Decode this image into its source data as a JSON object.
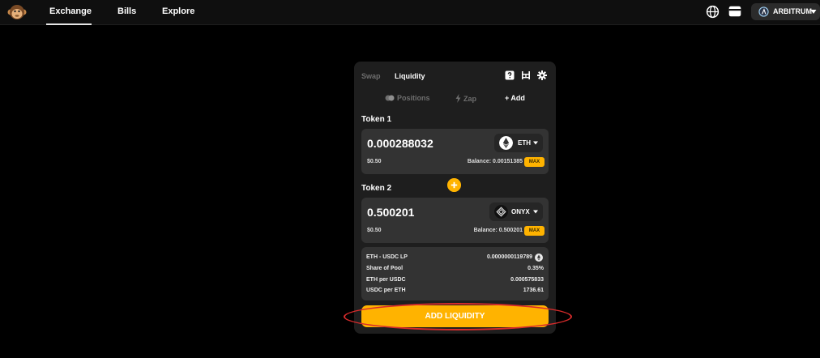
{
  "nav": {
    "items": [
      {
        "label": "Exchange",
        "active": true
      },
      {
        "label": "Bills",
        "active": false
      },
      {
        "label": "Explore",
        "active": false
      }
    ],
    "network_label": "ARBITRUM"
  },
  "card": {
    "tabs": [
      "Swap",
      "Liquidity"
    ],
    "active_tab": "Liquidity",
    "subtabs": {
      "positions": "Positions",
      "zap": "Zap",
      "add": "+ Add"
    },
    "token1": {
      "label": "Token 1",
      "amount": "0.000288032",
      "symbol": "ETH",
      "usd": "$0.50",
      "balance": "Balance: 0.00151385",
      "max_label": "MAX"
    },
    "token2": {
      "label": "Token 2",
      "amount": "0.500201",
      "symbol": "ONYX",
      "usd": "$0.50",
      "balance": "Balance: 0.500201",
      "max_label": "MAX"
    },
    "info": {
      "lp_label": "ETH - USDC LP",
      "lp_value": "0.0000000119789",
      "share_label": "Share of Pool",
      "share_value": "0.35%",
      "eth_per_usdc_label": "ETH per USDC",
      "eth_per_usdc_value": "0.000575833",
      "usdc_per_eth_label": "USDC per ETH",
      "usdc_per_eth_value": "1736.61"
    },
    "add_button": "ADD LIQUIDITY"
  },
  "colors": {
    "accent": "#ffb300",
    "card_bg": "#1e1e1e",
    "box_bg": "#333333",
    "highlight": "#d72b2b"
  }
}
